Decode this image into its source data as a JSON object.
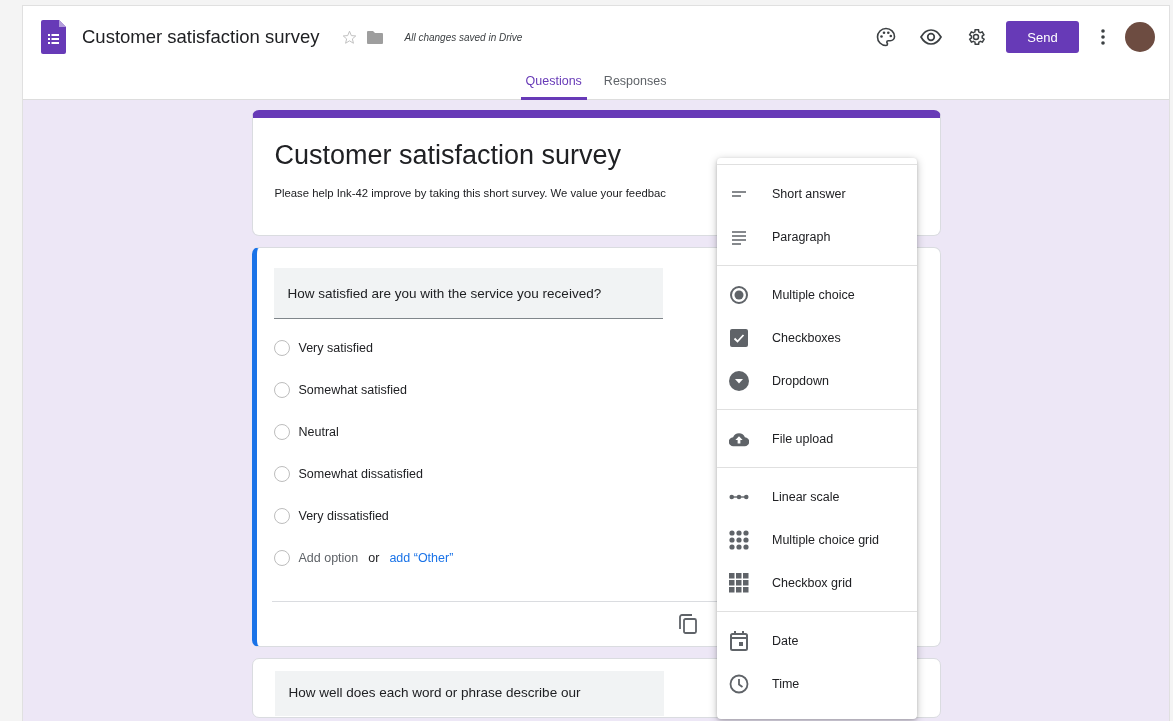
{
  "header": {
    "document_title": "Customer satisfaction survey",
    "save_status": "All changes saved in Drive",
    "send_button": "Send"
  },
  "tabs": [
    {
      "label": "Questions",
      "selected": true
    },
    {
      "label": "Responses",
      "selected": false
    }
  ],
  "form_header": {
    "title": "Customer satisfaction survey",
    "description": "Please help Ink-42 improve by taking this short survey. We value your feedbac"
  },
  "question": {
    "title": "How satisfied are you with the service you received?",
    "options": [
      {
        "label": "Very satisfied",
        "selected": false
      },
      {
        "label": "Somewhat satisfied",
        "selected": false
      },
      {
        "label": "Neutral",
        "selected": false
      },
      {
        "label": "Somewhat dissatisfied",
        "selected": false
      },
      {
        "label": "Very dissatisfied",
        "selected": false
      }
    ],
    "add_option": {
      "label": "Add option",
      "selected": false
    },
    "or": "or",
    "add_other": "add “Other”"
  },
  "next_question": {
    "title": "How well does each word or phrase describe our"
  },
  "question_type_menu": [
    [
      {
        "kind": "short",
        "label": "Short answer"
      },
      {
        "kind": "paragraph",
        "label": "Paragraph"
      }
    ],
    [
      {
        "kind": "radio",
        "label": "Multiple choice"
      },
      {
        "kind": "checkbox",
        "label": "Checkboxes"
      },
      {
        "kind": "dropdown",
        "label": "Dropdown"
      }
    ],
    [
      {
        "kind": "upload",
        "label": "File upload"
      }
    ],
    [
      {
        "kind": "scale",
        "label": "Linear scale"
      },
      {
        "kind": "radiogrid",
        "label": "Multiple choice grid"
      },
      {
        "kind": "checkgrid",
        "label": "Checkbox grid"
      }
    ],
    [
      {
        "kind": "date",
        "label": "Date"
      },
      {
        "kind": "time",
        "label": "Time"
      }
    ]
  ]
}
